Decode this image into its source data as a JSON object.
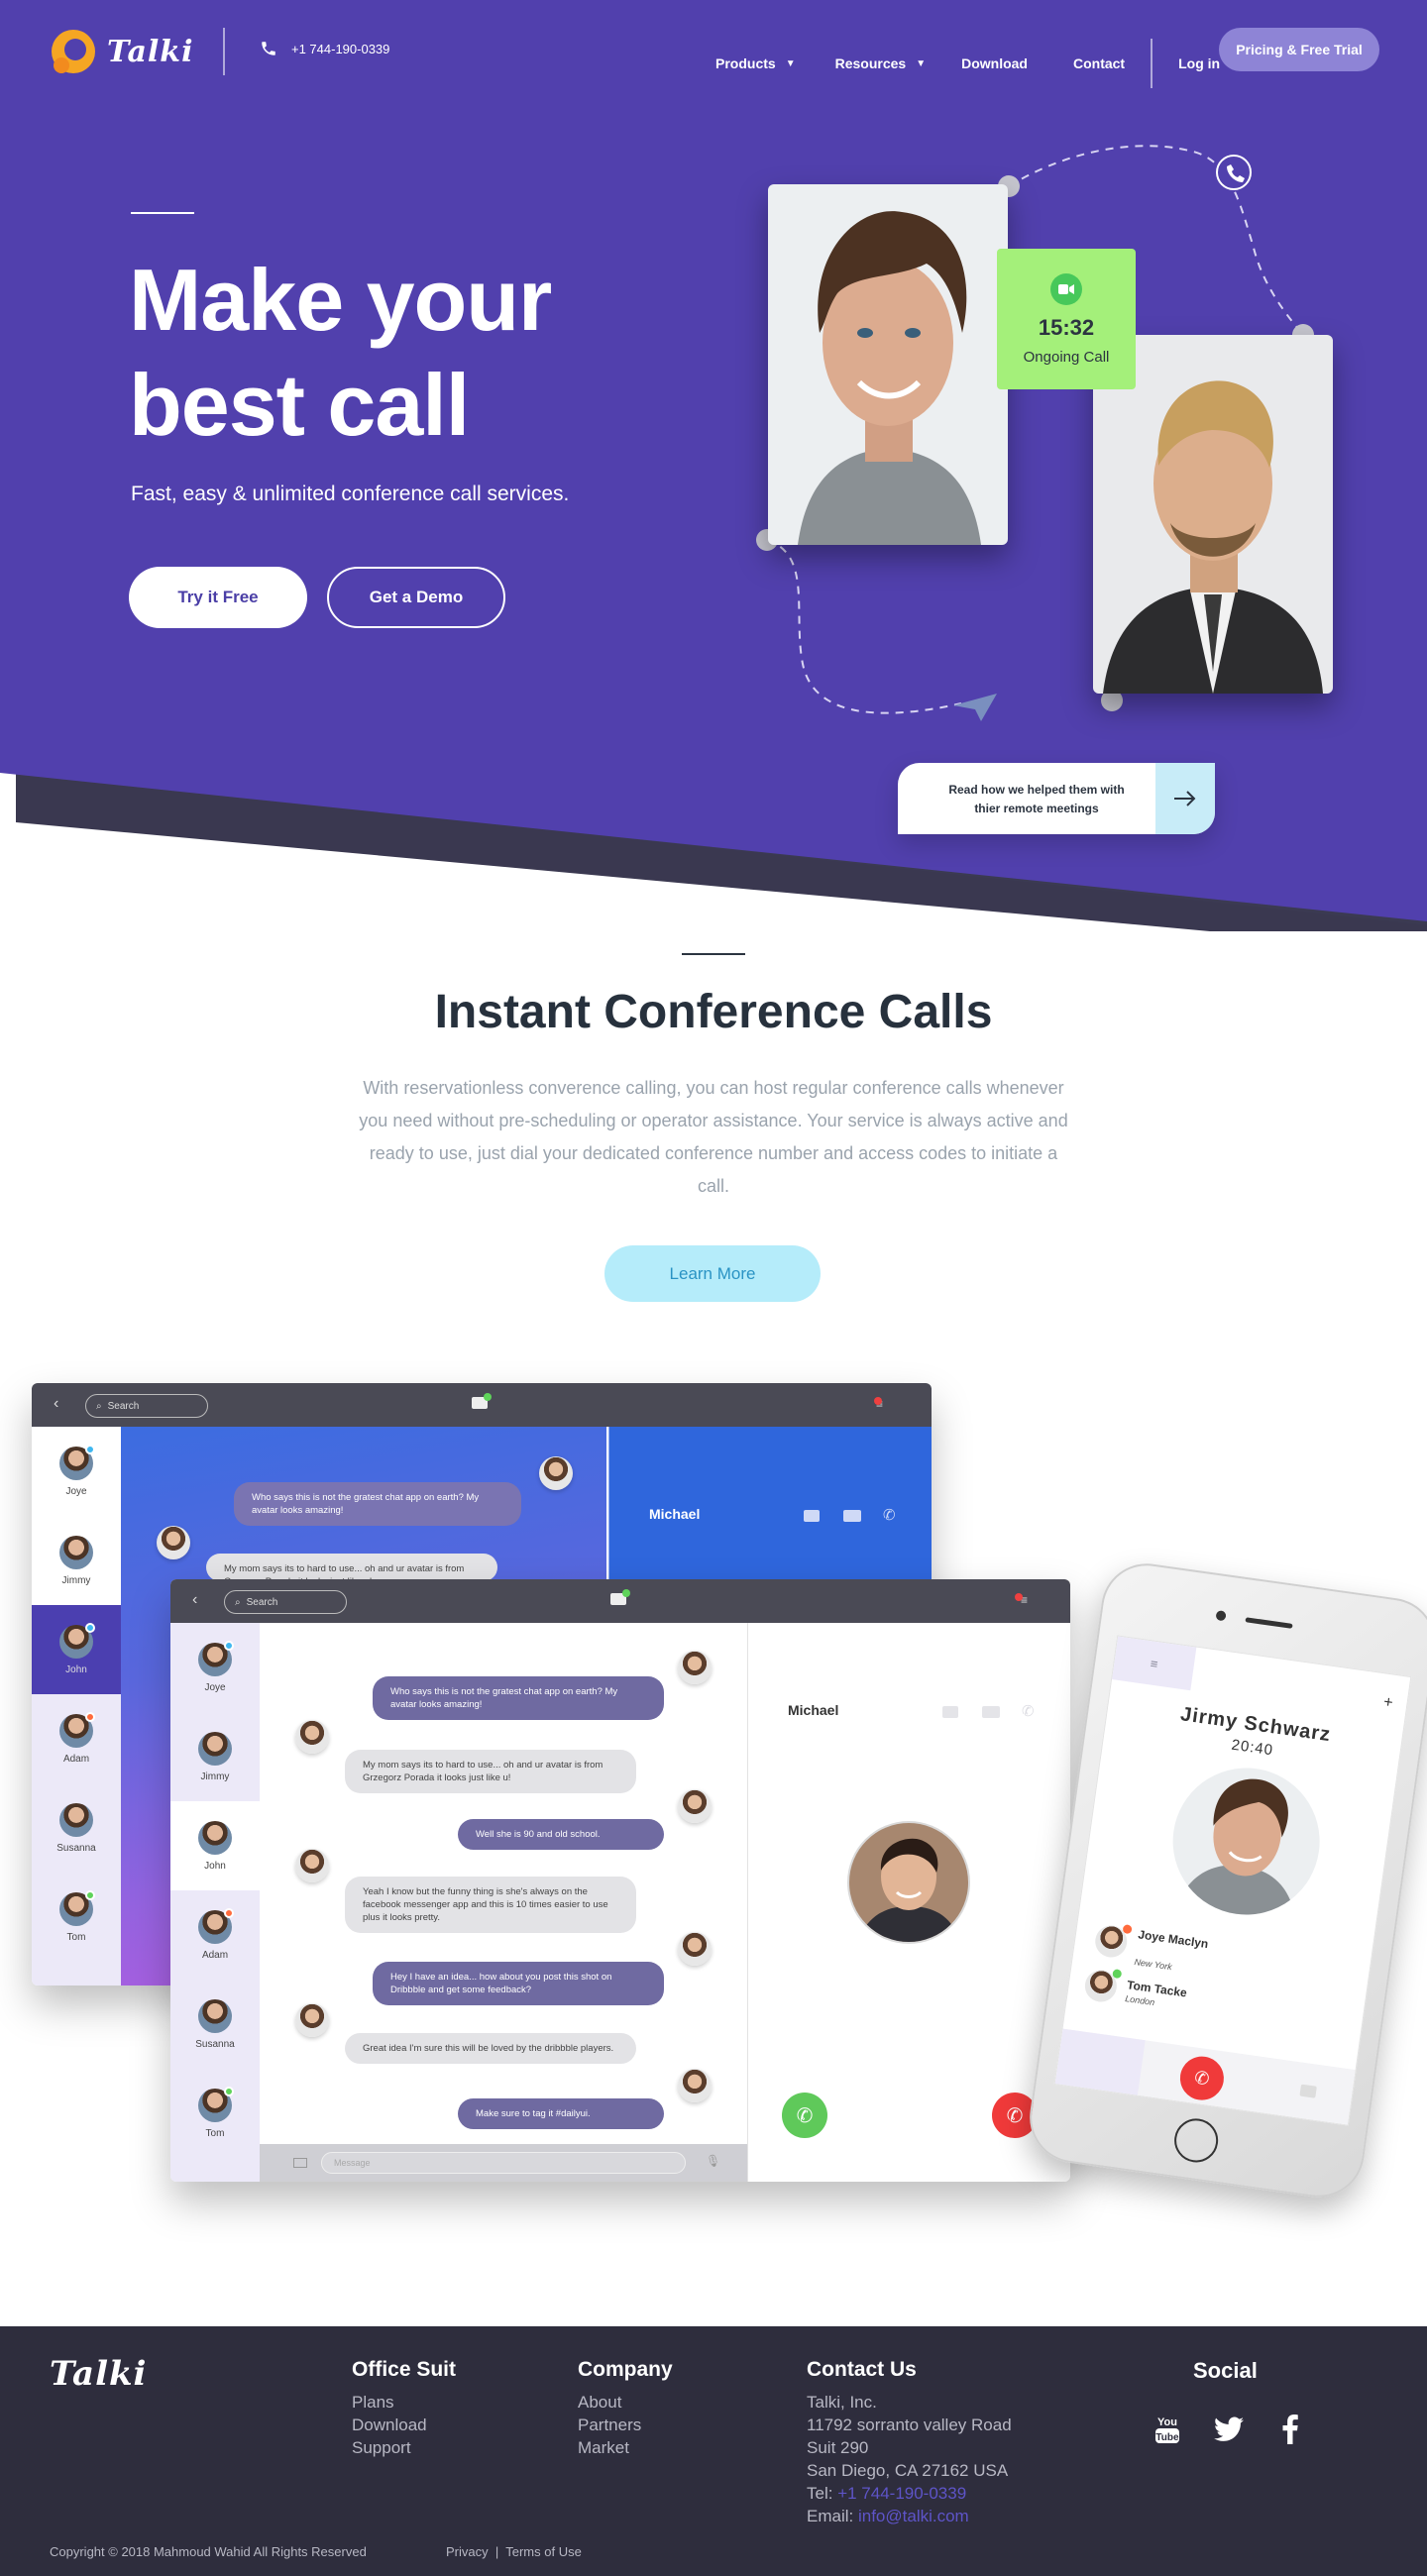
{
  "brand": {
    "name": "Talki",
    "primary": "#5140ad",
    "accent": "#f5a623"
  },
  "nav": {
    "phone": "+1 744-190-0339",
    "items": [
      {
        "label": "Products",
        "caret": true
      },
      {
        "label": "Resources",
        "caret": true
      },
      {
        "label": "Download",
        "caret": false
      },
      {
        "label": "Contact",
        "caret": false
      }
    ],
    "login": "Log in",
    "trial": "Pricing & Free Trial"
  },
  "hero": {
    "title_line1": "Make your",
    "title_line2": "best call",
    "subtitle": "Fast, easy & unlimited conference call services.",
    "primary_cta": "Try it Free",
    "secondary_cta": "Get a Demo",
    "call_time": "15:32",
    "call_status": "Ongoing Call",
    "read_more": "Read how we helped them with thier remote meetings"
  },
  "section": {
    "title": "Instant Conference Calls",
    "text": "With reservationless converence calling, you can host regular conference calls whenever you need without pre-scheduling or operator assistance. Your service is always active and ready to use, just dial your dedicated conference number and access codes to initiate a call.",
    "cta": "Learn More"
  },
  "app": {
    "search_placeholder": "Search",
    "contacts": [
      {
        "name": "Joye",
        "status": "#3fb7f0"
      },
      {
        "name": "Jimmy",
        "status": ""
      },
      {
        "name": "John",
        "status": "#3fb7f0"
      },
      {
        "name": "Adam",
        "status": "#ff6b3d"
      },
      {
        "name": "Susanna",
        "status": ""
      },
      {
        "name": "Tom",
        "status": "#5fd35a"
      }
    ],
    "active_contact": "Michael",
    "messages": [
      {
        "from": "me",
        "text": "Who says this is not the gratest chat app on earth? My avatar looks amazing!"
      },
      {
        "from": "them",
        "text": "My mom says its to hard to use... oh and ur avatar is from Grzegorz Porada it looks just like u!"
      },
      {
        "from": "me",
        "text": "Well she is 90 and old school."
      },
      {
        "from": "them",
        "text": "Yeah I know but the funny thing is she's always on the facebook messenger app and this is 10 times easier to use plus it looks pretty."
      },
      {
        "from": "me",
        "text": "Hey I have an idea... how about you post this shot on Dribbble and get some feedback?"
      },
      {
        "from": "them",
        "text": "Great idea I'm sure this will be loved by the dribbble players."
      },
      {
        "from": "me",
        "text": "Make sure to tag it #dailyui."
      }
    ],
    "message_placeholder": "Message"
  },
  "phone": {
    "caller": "Jirmy Schwarz",
    "duration": "20:40",
    "list": [
      {
        "name": "Joye Maclyn",
        "place": "New York"
      },
      {
        "name": "Tom Tacke",
        "place": "London"
      }
    ]
  },
  "footer": {
    "logo": "Talki",
    "office": {
      "title": "Office Suit",
      "links": [
        "Plans",
        "Download",
        "Support"
      ]
    },
    "company": {
      "title": "Company",
      "links": [
        "About",
        "Partners",
        "Market"
      ]
    },
    "contact": {
      "title": "Contact Us",
      "lines": [
        "Talki, Inc.",
        "11792 sorranto valley Road",
        "Suit 290",
        "San Diego, CA 27162 USA"
      ],
      "tel_label": "Tel: ",
      "tel": "+1 744-190-0339",
      "email_label": "Email: ",
      "email": "info@talki.com"
    },
    "social_title": "Social",
    "social": [
      "youtube-icon",
      "twitter-icon",
      "facebook-icon"
    ],
    "copyright": "Copyright © 2018 Mahmoud Wahid All Rights Reserved",
    "privacy": "Privacy",
    "terms": "Terms of Use"
  }
}
